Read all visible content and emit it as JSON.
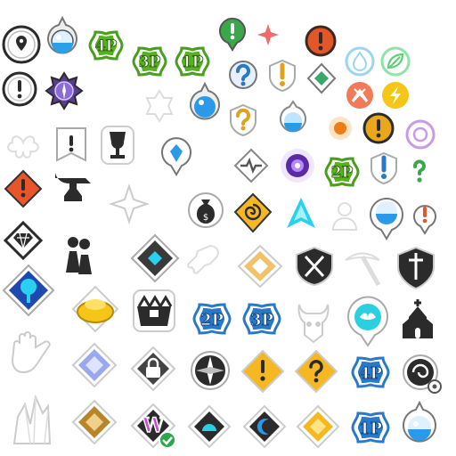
{
  "atlas": {
    "title": "",
    "player_badges": [
      {
        "label": "4P",
        "color": "#4a9e1e"
      },
      {
        "label": "3P",
        "color": "#4a9e1e"
      },
      {
        "label": "1P",
        "color": "#4a9e1e"
      },
      {
        "label": "2P",
        "color": "#4a9e1e"
      },
      {
        "label": "2P",
        "color": "#2a78c8"
      },
      {
        "label": "3P",
        "color": "#2a78c8"
      },
      {
        "label": "4P",
        "color": "#2a78c8"
      },
      {
        "label": "1P",
        "color": "#2a78c8"
      }
    ],
    "w_badge_label": "W",
    "colors": {
      "green": "#56b21f",
      "blue": "#2a78c8",
      "gold": "#e0a21a",
      "purple": "#7a4ec8",
      "outline": "#2b2b2b",
      "teal": "#2ad0e0"
    }
  }
}
